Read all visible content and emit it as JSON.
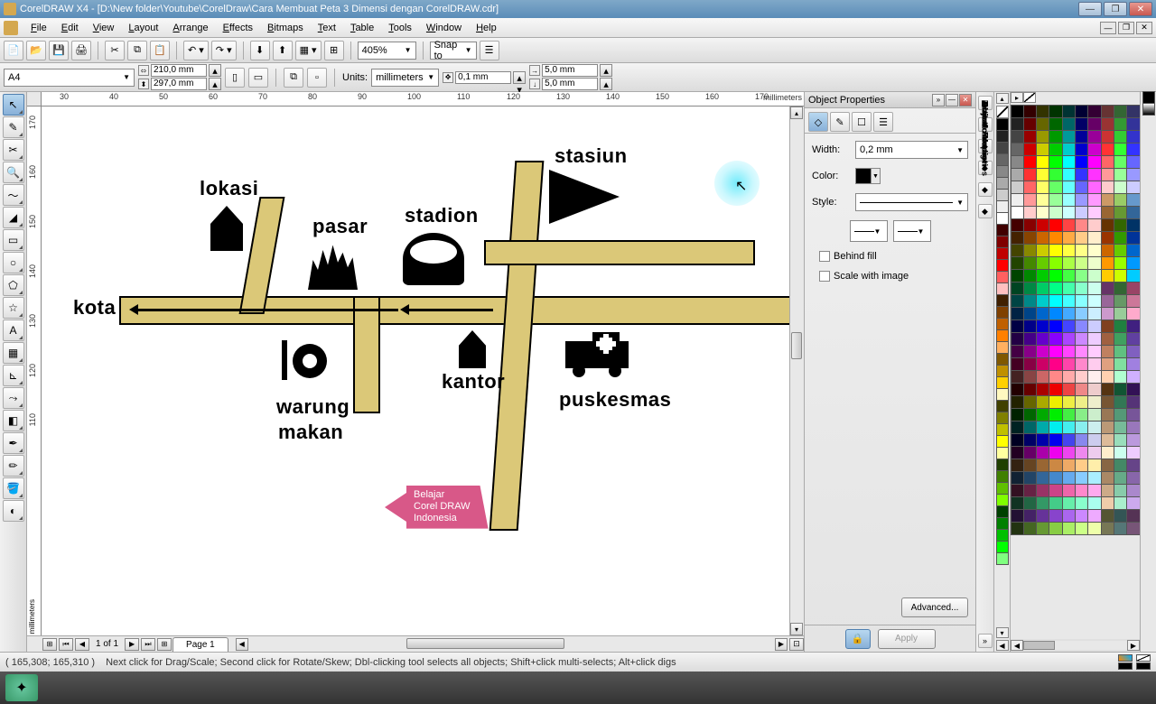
{
  "title": "CorelDRAW X4 - [D:\\New folder\\Youtube\\CorelDraw\\Cara Membuat Peta 3 Dimensi dengan CorelDRAW.cdr]",
  "menu": [
    "File",
    "Edit",
    "View",
    "Layout",
    "Arrange",
    "Effects",
    "Bitmaps",
    "Text",
    "Table",
    "Tools",
    "Window",
    "Help"
  ],
  "toolbar": {
    "zoom": "405%",
    "snap": "Snap to"
  },
  "propbar": {
    "page": "A4",
    "width": "210,0 mm",
    "height": "297,0 mm",
    "units_label": "Units:",
    "units": "millimeters",
    "nudge": "0,1 mm",
    "dup_x": "5,0 mm",
    "dup_y": "5,0 mm"
  },
  "ruler": {
    "h": [
      "30",
      "40",
      "50",
      "60",
      "70",
      "80",
      "90",
      "100",
      "110",
      "120",
      "130",
      "140",
      "150",
      "160",
      "170"
    ],
    "v": [
      "170",
      "160",
      "150",
      "140",
      "130",
      "120",
      "110"
    ],
    "unit": "millimeters"
  },
  "drawing": {
    "labels": {
      "kota": "kota",
      "lokasi": "lokasi",
      "pasar": "pasar",
      "stadion": "stadion",
      "stasiun": "stasiun",
      "kantor": "kantor",
      "warung": "warung",
      "makan": "makan",
      "puskesmas": "puskesmas"
    },
    "promo": {
      "line1": "Belajar",
      "line2": "Corel DRAW",
      "line3": "Indonesia"
    }
  },
  "pagetabs": {
    "info": "1 of 1",
    "tab": "Page 1"
  },
  "docker": {
    "title": "Object Properties",
    "width_label": "Width:",
    "width_value": "0,2 mm",
    "color_label": "Color:",
    "style_label": "Style:",
    "behind": "Behind fill",
    "scale": "Scale with image",
    "advanced": "Advanced...",
    "apply": "Apply"
  },
  "righttabs": [
    "Object Manager",
    "Hints",
    "Transformation",
    "Artistic Media",
    "Object Properties"
  ],
  "status": {
    "coords": "( 165,308; 165,310 )",
    "hint": "Next click for Drag/Scale; Second click for Rotate/Skew; Dbl-clicking tool selects all objects; Shift+click multi-selects; Alt+click digs"
  },
  "palette_narrow": [
    "#000",
    "#222",
    "#444",
    "#666",
    "#888",
    "#aaa",
    "#ccc",
    "#eee",
    "#fff",
    "#400000",
    "#800000",
    "#c00000",
    "#ff0000",
    "#ff6060",
    "#ffc0c0",
    "#402000",
    "#804000",
    "#c06000",
    "#ff8000",
    "#ffb060",
    "#805800",
    "#c09000",
    "#ffd000",
    "#fff8c0",
    "#404000",
    "#808000",
    "#c0c000",
    "#ffff00",
    "#ffffa0",
    "#204000",
    "#408000",
    "#60c000",
    "#80ff00",
    "#004000",
    "#008000",
    "#00c000",
    "#00ff00",
    "#80ff80"
  ],
  "palette_wide_colors": [
    [
      "#000",
      "#330000",
      "#333300",
      "#003300",
      "#003333",
      "#000033",
      "#330033",
      "#663333",
      "#336633",
      "#333366"
    ],
    [
      "#222",
      "#660000",
      "#666600",
      "#006600",
      "#006666",
      "#000066",
      "#660066",
      "#993333",
      "#339933",
      "#333399"
    ],
    [
      "#444",
      "#990000",
      "#999900",
      "#009900",
      "#009999",
      "#000099",
      "#990099",
      "#cc3333",
      "#33cc33",
      "#3333cc"
    ],
    [
      "#666",
      "#cc0000",
      "#cccc00",
      "#00cc00",
      "#00cccc",
      "#0000cc",
      "#cc00cc",
      "#ff3333",
      "#33ff33",
      "#3333ff"
    ],
    [
      "#888",
      "#ff0000",
      "#ffff00",
      "#00ff00",
      "#00ffff",
      "#0000ff",
      "#ff00ff",
      "#ff6666",
      "#66ff66",
      "#6666ff"
    ],
    [
      "#aaa",
      "#ff3333",
      "#ffff33",
      "#33ff33",
      "#33ffff",
      "#3333ff",
      "#ff33ff",
      "#ff9999",
      "#99ff99",
      "#9999ff"
    ],
    [
      "#ccc",
      "#ff6666",
      "#ffff66",
      "#66ff66",
      "#66ffff",
      "#6666ff",
      "#ff66ff",
      "#ffcccc",
      "#ccffcc",
      "#ccccff"
    ],
    [
      "#eee",
      "#ff9999",
      "#ffff99",
      "#99ff99",
      "#99ffff",
      "#9999ff",
      "#ff99ff",
      "#cc9966",
      "#99cc66",
      "#6699cc"
    ],
    [
      "#fff",
      "#ffcccc",
      "#ffffcc",
      "#ccffcc",
      "#ccffff",
      "#ccccff",
      "#ffccff",
      "#996633",
      "#669933",
      "#336699"
    ],
    [
      "#400",
      "#800",
      "#c00",
      "#f00",
      "#f44",
      "#f88",
      "#fcc",
      "#663300",
      "#336600",
      "#003366"
    ],
    [
      "#420",
      "#840",
      "#c60",
      "#f80",
      "#fa4",
      "#fc8",
      "#fec",
      "#993300",
      "#339900",
      "#003399"
    ],
    [
      "#440",
      "#880",
      "#cc0",
      "#ff0",
      "#ff4",
      "#ff8",
      "#ffc",
      "#cc6600",
      "#66cc00",
      "#0066cc"
    ],
    [
      "#240",
      "#480",
      "#6c0",
      "#8f0",
      "#af4",
      "#cf8",
      "#efc",
      "#ff9900",
      "#99ff00",
      "#0099ff"
    ],
    [
      "#040",
      "#080",
      "#0c0",
      "#0f0",
      "#4f4",
      "#8f8",
      "#cfc",
      "#ffcc00",
      "#ccff00",
      "#00ccff"
    ],
    [
      "#042",
      "#084",
      "#0c6",
      "#0f8",
      "#4fa",
      "#8fc",
      "#cfe",
      "#663366",
      "#336633",
      "#994466"
    ],
    [
      "#044",
      "#088",
      "#0cc",
      "#0ff",
      "#4ff",
      "#8ff",
      "#cff",
      "#996699",
      "#669966",
      "#cc7799"
    ],
    [
      "#024",
      "#048",
      "#06c",
      "#08f",
      "#4af",
      "#8cf",
      "#cef",
      "#cc99cc",
      "#99cc99",
      "#ffaacc"
    ],
    [
      "#004",
      "#008",
      "#00c",
      "#00f",
      "#44f",
      "#88f",
      "#ccf",
      "#804020",
      "#208040",
      "#402080"
    ],
    [
      "#204",
      "#408",
      "#60c",
      "#80f",
      "#a4f",
      "#c8f",
      "#ecf",
      "#a06040",
      "#40a060",
      "#6040a0"
    ],
    [
      "#404",
      "#808",
      "#c0c",
      "#f0f",
      "#f4f",
      "#f8f",
      "#fcf",
      "#c08060",
      "#60c080",
      "#8060c0"
    ],
    [
      "#402",
      "#804",
      "#c06",
      "#f08",
      "#f4a",
      "#f8c",
      "#fce",
      "#e0a080",
      "#80e0a0",
      "#a080e0"
    ],
    [
      "#422",
      "#844",
      "#c66",
      "#f88",
      "#faa",
      "#fcc",
      "#fee",
      "#ffd0b0",
      "#b0ffd0",
      "#d0b0ff"
    ],
    [
      "#200",
      "#600",
      "#a00",
      "#e00",
      "#e44",
      "#e88",
      "#ecc",
      "#553311",
      "#115533",
      "#331155"
    ],
    [
      "#220",
      "#660",
      "#aa0",
      "#ee0",
      "#ee4",
      "#ee8",
      "#eec",
      "#775533",
      "#337755",
      "#553377"
    ],
    [
      "#020",
      "#060",
      "#0a0",
      "#0e0",
      "#4e4",
      "#8e8",
      "#cec",
      "#997755",
      "#559977",
      "#775599"
    ],
    [
      "#022",
      "#066",
      "#0aa",
      "#0ee",
      "#4ee",
      "#8ee",
      "#cee",
      "#bb9977",
      "#77bb99",
      "#9977bb"
    ],
    [
      "#002",
      "#006",
      "#00a",
      "#00e",
      "#44e",
      "#88e",
      "#cce",
      "#ddbb99",
      "#99ddbb",
      "#bb99dd"
    ],
    [
      "#202",
      "#606",
      "#a0a",
      "#e0e",
      "#e4e",
      "#e8e",
      "#ece",
      "#ffeecc",
      "#ccffee",
      "#eeccff"
    ],
    [
      "#321",
      "#642",
      "#963",
      "#c84",
      "#ea6",
      "#fc8",
      "#fea",
      "#886644",
      "#448866",
      "#664488"
    ],
    [
      "#123",
      "#246",
      "#369",
      "#48c",
      "#6ae",
      "#8cf",
      "#aef",
      "#aa8866",
      "#66aa88",
      "#8866aa"
    ],
    [
      "#312",
      "#624",
      "#936",
      "#c48",
      "#e6a",
      "#f8c",
      "#fae",
      "#ccaa88",
      "#88ccaa",
      "#aa88cc"
    ],
    [
      "#132",
      "#264",
      "#396",
      "#4c8",
      "#6ea",
      "#8fc",
      "#afe",
      "#eeccaa",
      "#aaeecc",
      "#ccaaee"
    ],
    [
      "#213",
      "#426",
      "#639",
      "#84c",
      "#a6e",
      "#c8f",
      "#eaf",
      "#555533",
      "#335555",
      "#553355"
    ],
    [
      "#231",
      "#462",
      "#693",
      "#8c4",
      "#ae6",
      "#cf8",
      "#efa",
      "#777755",
      "#557777",
      "#775577"
    ]
  ]
}
